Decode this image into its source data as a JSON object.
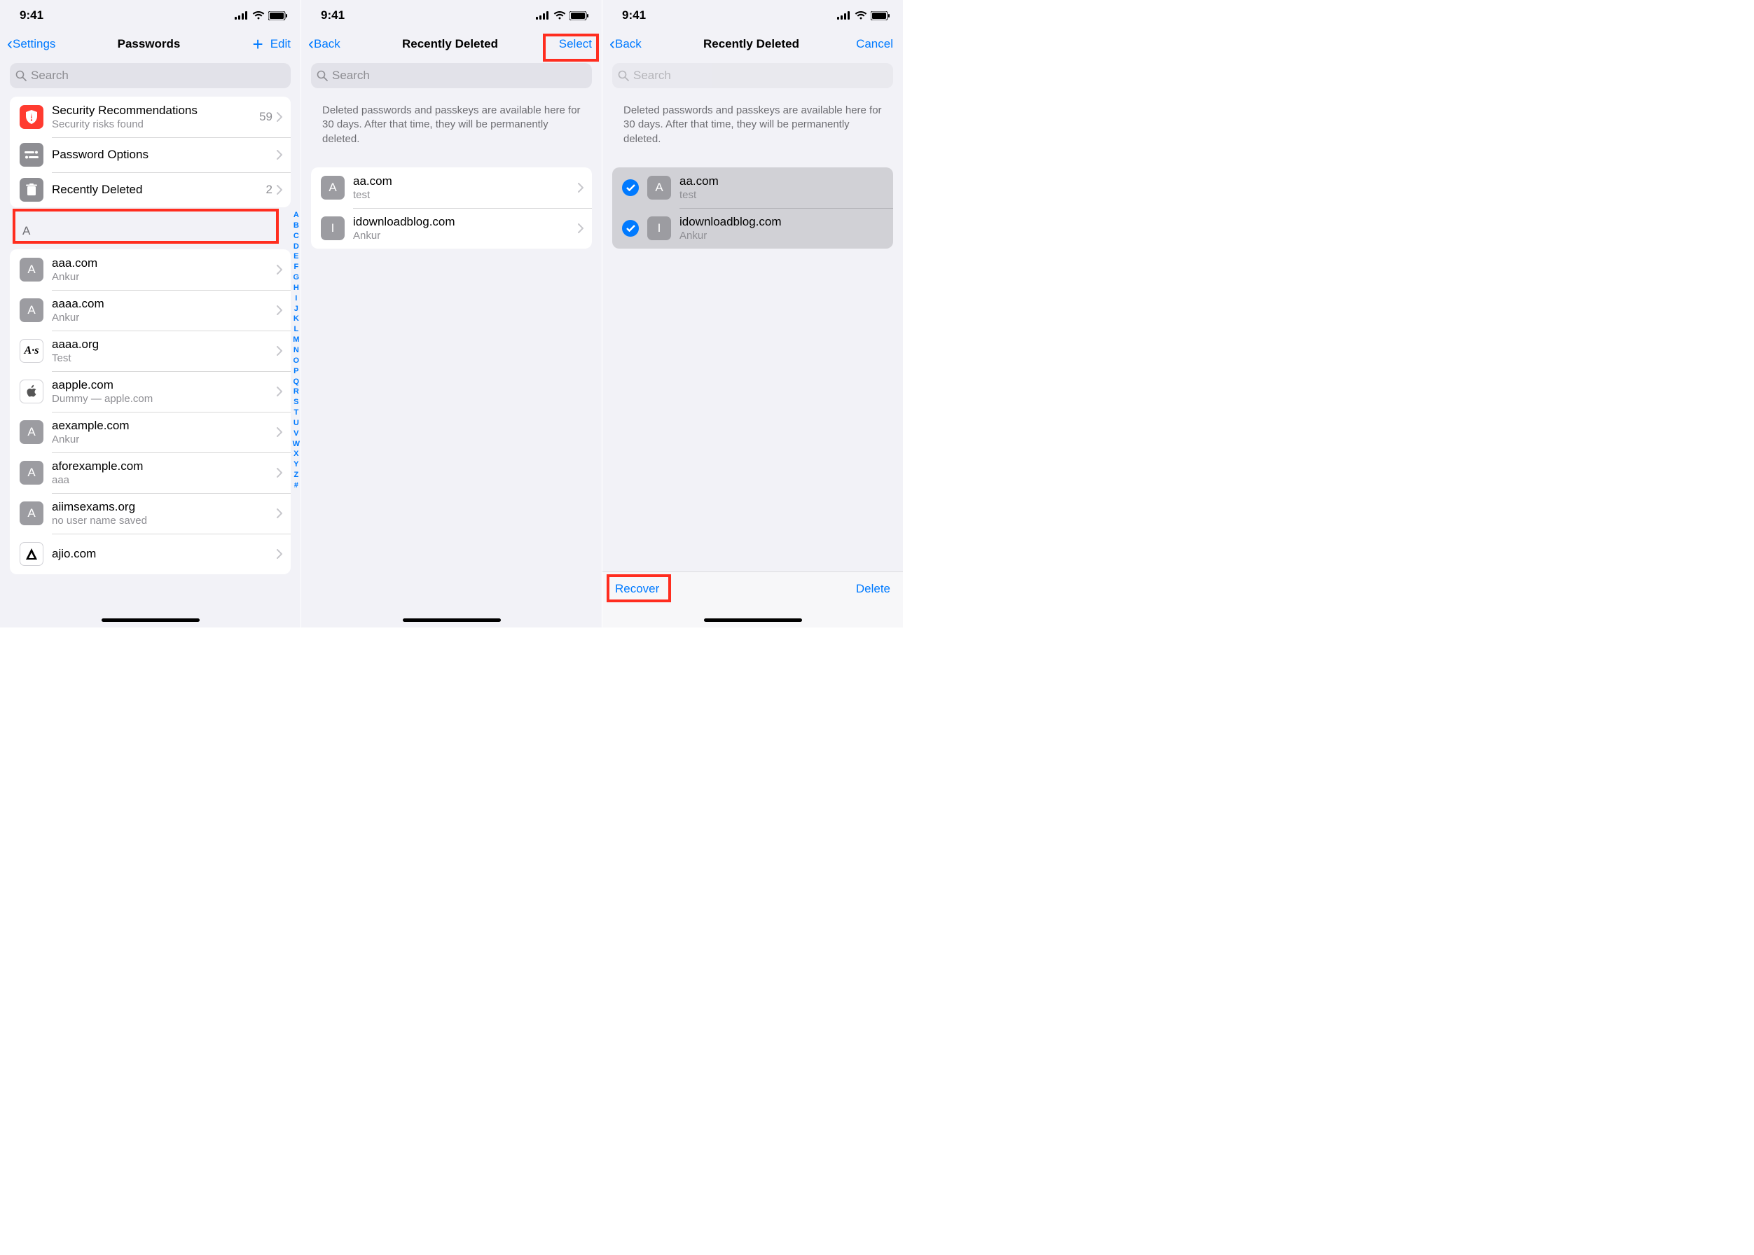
{
  "status": {
    "time": "9:41"
  },
  "screen1": {
    "nav": {
      "back": "Settings",
      "title": "Passwords",
      "edit": "Edit"
    },
    "search": {
      "placeholder": "Search"
    },
    "top_group": [
      {
        "title": "Security Recommendations",
        "sub": "Security risks found",
        "tail": "59"
      },
      {
        "title": "Password Options"
      },
      {
        "title": "Recently Deleted",
        "tail": "2"
      }
    ],
    "section": "A",
    "pw_list": [
      {
        "letter": "A",
        "title": "aaa.com",
        "sub": "Ankur"
      },
      {
        "letter": "A",
        "title": "aaaa.com",
        "sub": "Ankur"
      },
      {
        "letter": "A·s",
        "title": "aaaa.org",
        "sub": "Test",
        "script": true
      },
      {
        "apple": true,
        "title": "aapple.com",
        "sub": "Dummy — apple.com"
      },
      {
        "letter": "A",
        "title": "aexample.com",
        "sub": "Ankur"
      },
      {
        "letter": "A",
        "title": "aforexample.com",
        "sub": "aaa"
      },
      {
        "letter": "A",
        "title": "aiimsexams.org",
        "sub": "no user name saved"
      },
      {
        "logo": true,
        "title": "ajio.com",
        "sub": ""
      }
    ],
    "index": [
      "A",
      "B",
      "C",
      "D",
      "E",
      "F",
      "G",
      "H",
      "I",
      "J",
      "K",
      "L",
      "M",
      "N",
      "O",
      "P",
      "Q",
      "R",
      "S",
      "T",
      "U",
      "V",
      "W",
      "X",
      "Y",
      "Z",
      "#"
    ]
  },
  "screen2": {
    "nav": {
      "back": "Back",
      "title": "Recently Deleted",
      "select": "Select"
    },
    "search": {
      "placeholder": "Search"
    },
    "desc": "Deleted passwords and passkeys are available here for 30 days. After that time, they will be permanently deleted.",
    "items": [
      {
        "letter": "A",
        "title": "aa.com",
        "sub": "test"
      },
      {
        "letter": "I",
        "title": "idownloadblog.com",
        "sub": "Ankur"
      }
    ]
  },
  "screen3": {
    "nav": {
      "back": "Back",
      "title": "Recently Deleted",
      "cancel": "Cancel"
    },
    "search": {
      "placeholder": "Search"
    },
    "desc": "Deleted passwords and passkeys are available here for 30 days. After that time, they will be permanently deleted.",
    "items": [
      {
        "letter": "A",
        "title": "aa.com",
        "sub": "test"
      },
      {
        "letter": "I",
        "title": "idownloadblog.com",
        "sub": "Ankur"
      }
    ],
    "toolbar": {
      "recover": "Recover",
      "delete": "Delete"
    }
  }
}
